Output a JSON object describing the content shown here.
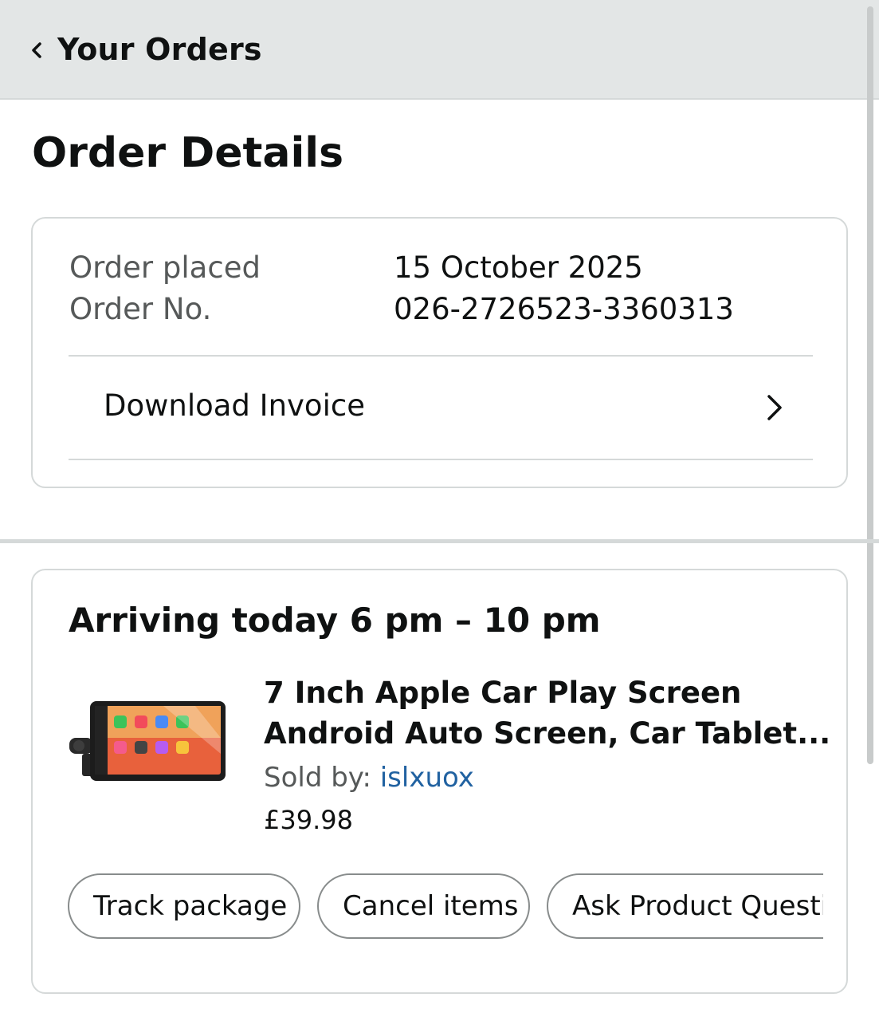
{
  "header": {
    "back_title": "Your Orders"
  },
  "page": {
    "title": "Order Details"
  },
  "order_info": {
    "placed_label": "Order placed",
    "placed_value": "15 October 2025",
    "number_label": "Order No.",
    "number_value": "026-2726523-3360313",
    "invoice_label": "Download Invoice"
  },
  "shipment": {
    "arrival": "Arriving today 6 pm – 10 pm",
    "product": {
      "title_line1": "7 Inch Apple Car Play Screen",
      "title_line2": "Android Auto Screen, Car Tablet...",
      "sold_by_label": "Sold by: ",
      "seller": "islxuox",
      "price": "£39.98"
    },
    "actions": {
      "track": "Track package",
      "cancel": "Cancel items",
      "ask": "Ask Product Question"
    }
  },
  "colors": {
    "header_bg": "#e3e6e6",
    "link": "#2162a1",
    "border": "#d5d9d9"
  }
}
